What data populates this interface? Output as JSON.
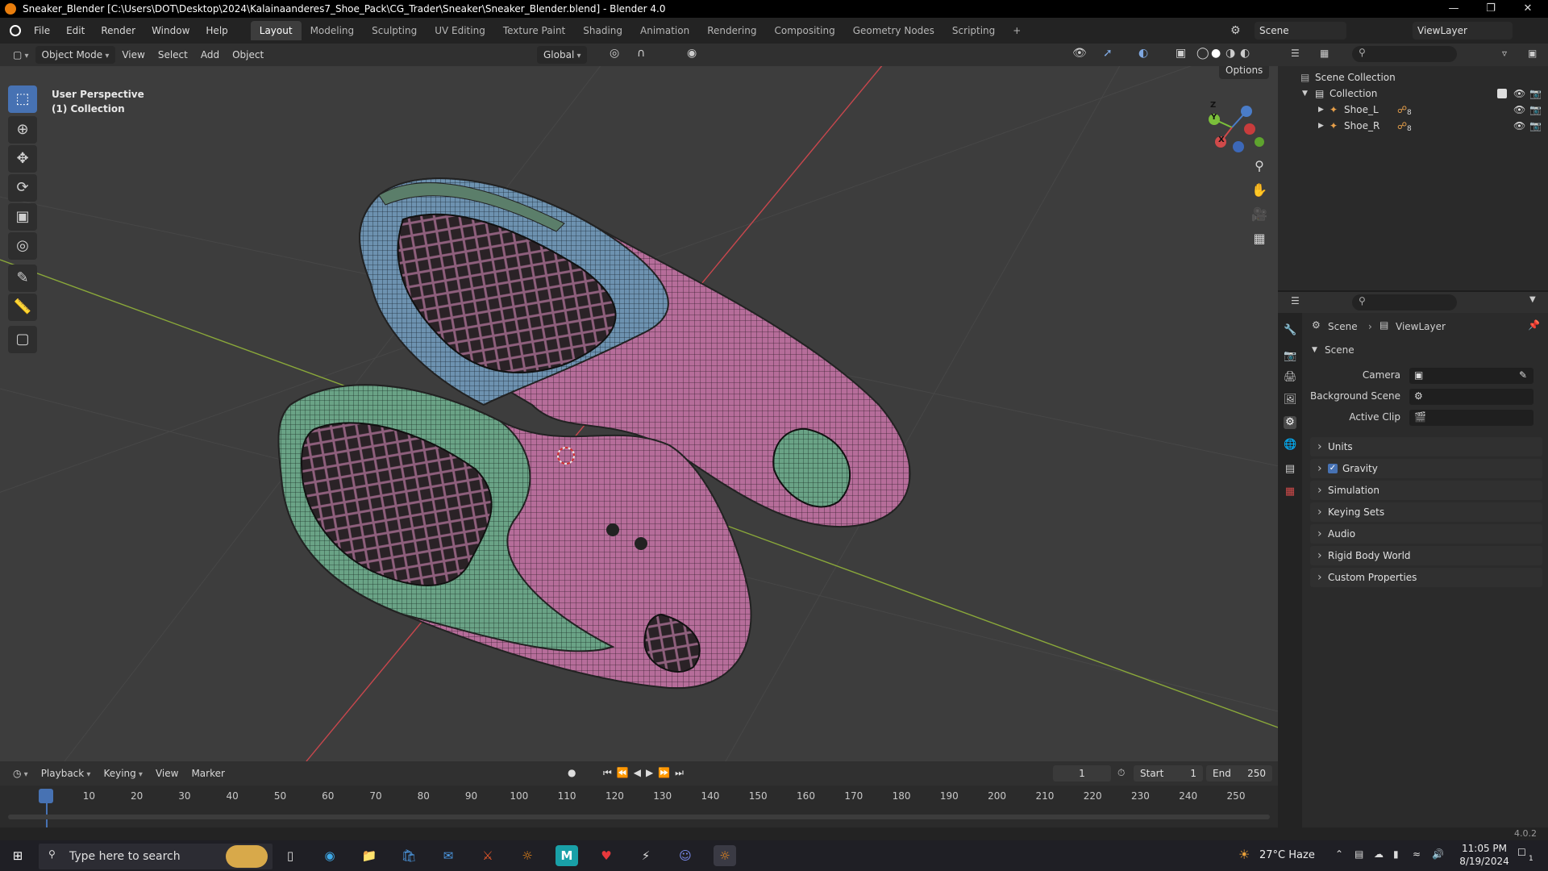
{
  "window": {
    "title": "Sneaker_Blender [C:\\Users\\DOT\\Desktop\\2024\\Kalainaanderes7_Shoe_Pack\\CG_Trader\\Sneaker\\Sneaker_Blender.blend] - Blender 4.0"
  },
  "menubar": {
    "menus": [
      "File",
      "Edit",
      "Render",
      "Window",
      "Help"
    ],
    "workspaces": [
      "Layout",
      "Modeling",
      "Sculpting",
      "UV Editing",
      "Texture Paint",
      "Shading",
      "Animation",
      "Rendering",
      "Compositing",
      "Geometry Nodes",
      "Scripting"
    ],
    "active_workspace": "Layout",
    "add_tab": "+",
    "scene": "Scene",
    "view_layer": "ViewLayer"
  },
  "viewport_header": {
    "mode": "Object Mode",
    "menus": [
      "View",
      "Select",
      "Add",
      "Object"
    ],
    "orientation": "Global",
    "options": "Options"
  },
  "viewport": {
    "perspective": "User Perspective",
    "collection": "(1) Collection",
    "gizmo_axes": [
      "Z",
      "Y",
      "X"
    ]
  },
  "outliner": {
    "root": "Scene Collection",
    "collection": "Collection",
    "objects": [
      {
        "name": "Shoe_L",
        "modifier_count": "8"
      },
      {
        "name": "Shoe_R",
        "modifier_count": "8"
      }
    ]
  },
  "properties": {
    "breadcrumb_scene": "Scene",
    "breadcrumb_layer": "ViewLayer",
    "section": "Scene",
    "fields": [
      {
        "label": "Camera"
      },
      {
        "label": "Background Scene"
      },
      {
        "label": "Active Clip"
      }
    ],
    "panels": [
      "Units",
      "Gravity",
      "Simulation",
      "Keying Sets",
      "Audio",
      "Rigid Body World",
      "Custom Properties"
    ],
    "gravity_checked": true
  },
  "timeline": {
    "menus": [
      "Playback",
      "Keying",
      "View",
      "Marker"
    ],
    "current_frame": "1",
    "start_label": "Start",
    "start": "1",
    "end_label": "End",
    "end": "250",
    "ticks": [
      "1",
      "10",
      "20",
      "30",
      "40",
      "50",
      "60",
      "70",
      "80",
      "90",
      "100",
      "110",
      "120",
      "130",
      "140",
      "150",
      "160",
      "170",
      "180",
      "190",
      "200",
      "210",
      "220",
      "230",
      "240",
      "250"
    ]
  },
  "status": {
    "version": "4.0.2"
  },
  "taskbar": {
    "search_placeholder": "Type here to search",
    "weather": "27°C  Haze",
    "time": "11:05 PM",
    "date": "8/19/2024",
    "notification_count": "1"
  },
  "colors": {
    "accent": "#4772b3",
    "shoe_pink": "#b66d9a",
    "shoe_green": "#6aa386",
    "shoe_blue": "#6d92b0"
  }
}
